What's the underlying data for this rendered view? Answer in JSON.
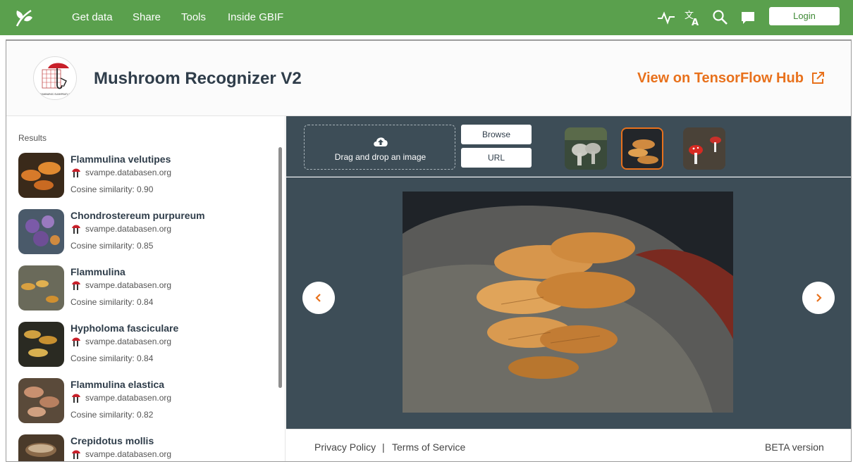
{
  "nav": {
    "items": [
      "Get data",
      "Share",
      "Tools",
      "Inside GBIF"
    ],
    "icons": [
      "activity-icon",
      "translate-icon",
      "search-icon",
      "feedback-icon"
    ],
    "login_label": "Login"
  },
  "header": {
    "title": "Mushroom Recognizer V2",
    "tfhub_label": "View on TensorFlow Hub",
    "logo_caption": "DANMARKS SVAMPEATLAS"
  },
  "sidebar": {
    "results_label": "Results",
    "results": [
      {
        "name": "Flammulina velutipes",
        "source": "svampe.databasen.org",
        "similarity": "Cosine similarity: 0.90"
      },
      {
        "name": "Chondrostereum purpureum",
        "source": "svampe.databasen.org",
        "similarity": "Cosine similarity: 0.85"
      },
      {
        "name": "Flammulina",
        "source": "svampe.databasen.org",
        "similarity": "Cosine similarity: 0.84"
      },
      {
        "name": "Hypholoma fasciculare",
        "source": "svampe.databasen.org",
        "similarity": "Cosine similarity: 0.84"
      },
      {
        "name": "Flammulina elastica",
        "source": "svampe.databasen.org",
        "similarity": "Cosine similarity: 0.82"
      },
      {
        "name": "Crepidotus mollis",
        "source": "svampe.databasen.org",
        "similarity": ""
      }
    ]
  },
  "toolbar": {
    "drop_text": "Drag and drop an image",
    "browse_label": "Browse",
    "url_label": "URL"
  },
  "footer": {
    "privacy": "Privacy Policy",
    "separator": "|",
    "terms": "Terms of Service",
    "beta": "BETA version"
  },
  "colors": {
    "nav_green": "#5aa04d",
    "accent_orange": "#e8711c",
    "panel_dark": "#3d4d57"
  }
}
